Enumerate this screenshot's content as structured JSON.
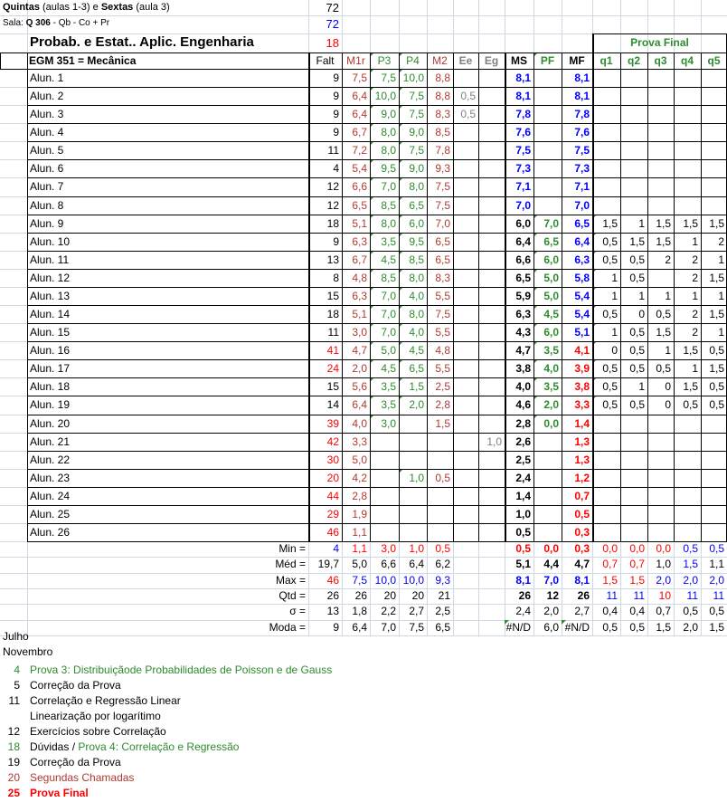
{
  "header": {
    "days_b1": "Quintas",
    "days_n1": " (aulas 1-3) e ",
    "days_b2": "Sextas",
    "days_n2": " (aula 3)",
    "days_val": "72",
    "room_label": "Sala: ",
    "room_b": "Q 306",
    "room_rest": " - Qb - Co + Pr",
    "room_val": "72",
    "title": "Probab. e Estat.. Aplic. Engenharia",
    "title_val": "18",
    "course": "EGM 351 = Mecânica",
    "prova_final": "Prova Final"
  },
  "columns": [
    "Falt",
    "M1r",
    "P3",
    "P4",
    "M2",
    "Ee",
    "Eg",
    "MS",
    "PF",
    "MF",
    "q1",
    "q2",
    "q3",
    "q4",
    "q5"
  ],
  "students": [
    {
      "name": "Alun. 1",
      "falt": "9",
      "m1r": "7,5",
      "p3": "7,5",
      "p4": "10,0",
      "m2": "8,8",
      "ee": "",
      "eg": "",
      "ms": "8,1",
      "pf": "",
      "mf": "8,1",
      "q": [
        "",
        "",
        "",
        "",
        ""
      ]
    },
    {
      "name": "Alun. 2",
      "falt": "9",
      "m1r": "6,4",
      "p3": "10,0",
      "p4": "7,5",
      "m2": "8,8",
      "ee": "0,5",
      "eg": "",
      "ms": "8,1",
      "pf": "",
      "mf": "8,1",
      "q": [
        "",
        "",
        "",
        "",
        ""
      ]
    },
    {
      "name": "Alun. 3",
      "falt": "9",
      "m1r": "6,4",
      "p3": "9,0",
      "p4": "7,5",
      "m2": "8,3",
      "ee": "0,5",
      "eg": "",
      "ms": "7,8",
      "pf": "",
      "mf": "7,8",
      "q": [
        "",
        "",
        "",
        "",
        ""
      ]
    },
    {
      "name": "Alun. 4",
      "falt": "9",
      "m1r": "6,7",
      "p3": "8,0",
      "p4": "9,0",
      "m2": "8,5",
      "ee": "",
      "eg": "",
      "ms": "7,6",
      "pf": "",
      "mf": "7,6",
      "q": [
        "",
        "",
        "",
        "",
        ""
      ]
    },
    {
      "name": "Alun. 5",
      "falt": "11",
      "m1r": "7,2",
      "p3": "8,0",
      "p4": "7,5",
      "m2": "7,8",
      "ee": "",
      "eg": "",
      "ms": "7,5",
      "pf": "",
      "mf": "7,5",
      "q": [
        "",
        "",
        "",
        "",
        ""
      ]
    },
    {
      "name": "Alun. 6",
      "falt": "4",
      "m1r": "5,4",
      "p3": "9,5",
      "p4": "9,0",
      "m2": "9,3",
      "ee": "",
      "eg": "",
      "ms": "7,3",
      "pf": "",
      "mf": "7,3",
      "q": [
        "",
        "",
        "",
        "",
        ""
      ]
    },
    {
      "name": "Alun. 7",
      "falt": "12",
      "m1r": "6,6",
      "p3": "7,0",
      "p4": "8,0",
      "m2": "7,5",
      "ee": "",
      "eg": "",
      "ms": "7,1",
      "pf": "",
      "mf": "7,1",
      "q": [
        "",
        "",
        "",
        "",
        ""
      ]
    },
    {
      "name": "Alun. 8",
      "falt": "12",
      "m1r": "6,5",
      "p3": "8,5",
      "p4": "6,5",
      "m2": "7,5",
      "ee": "",
      "eg": "",
      "ms": "7,0",
      "pf": "",
      "mf": "7,0",
      "q": [
        "",
        "",
        "",
        "",
        ""
      ]
    },
    {
      "name": "Alun. 9",
      "falt": "18",
      "m1r": "5,1",
      "p3": "8,0",
      "p4": "6,0",
      "m2": "7,0",
      "ee": "",
      "eg": "",
      "ms": "6,0",
      "pf": "7,0",
      "mf": "6,5",
      "q": [
        "1,5",
        "1",
        "1,5",
        "1,5",
        "1,5"
      ]
    },
    {
      "name": "Alun. 10",
      "falt": "9",
      "m1r": "6,3",
      "p3": "3,5",
      "p4": "9,5",
      "m2": "6,5",
      "ee": "",
      "eg": "",
      "ms": "6,4",
      "pf": "6,5",
      "mf": "6,4",
      "q": [
        "0,5",
        "1,5",
        "1,5",
        "1",
        "2"
      ]
    },
    {
      "name": "Alun. 11",
      "falt": "13",
      "m1r": "6,7",
      "p3": "4,5",
      "p4": "8,5",
      "m2": "6,5",
      "ee": "",
      "eg": "",
      "ms": "6,6",
      "pf": "6,0",
      "mf": "6,3",
      "q": [
        "0,5",
        "0,5",
        "2",
        "2",
        "1"
      ]
    },
    {
      "name": "Alun. 12",
      "falt": "8",
      "m1r": "4,8",
      "p3": "8,5",
      "p4": "8,0",
      "m2": "8,3",
      "ee": "",
      "eg": "",
      "ms": "6,5",
      "pf": "5,0",
      "mf": "5,8",
      "q": [
        "1",
        "0,5",
        "",
        "2",
        "1,5"
      ]
    },
    {
      "name": "Alun. 13",
      "falt": "15",
      "m1r": "6,3",
      "p3": "7,0",
      "p4": "4,0",
      "m2": "5,5",
      "ee": "",
      "eg": "",
      "ms": "5,9",
      "pf": "5,0",
      "mf": "5,4",
      "q": [
        "1",
        "1",
        "1",
        "1",
        "1"
      ]
    },
    {
      "name": "Alun. 14",
      "falt": "18",
      "m1r": "5,1",
      "p3": "7,0",
      "p4": "8,0",
      "m2": "7,5",
      "ee": "",
      "eg": "",
      "ms": "6,3",
      "pf": "4,5",
      "mf": "5,4",
      "q": [
        "0,5",
        "0",
        "0,5",
        "2",
        "1,5"
      ]
    },
    {
      "name": "Alun. 15",
      "falt": "11",
      "m1r": "3,0",
      "p3": "7,0",
      "p4": "4,0",
      "m2": "5,5",
      "ee": "",
      "eg": "",
      "ms": "4,3",
      "pf": "6,0",
      "mf": "5,1",
      "q": [
        "1",
        "0,5",
        "1,5",
        "2",
        "1"
      ]
    },
    {
      "name": "Alun. 16",
      "falt": "41",
      "m1r": "4,7",
      "p3": "5,0",
      "p4": "4,5",
      "m2": "4,8",
      "ee": "",
      "eg": "",
      "ms": "4,7",
      "pf": "3,5",
      "mf": "4,1",
      "q": [
        "0",
        "0,5",
        "1",
        "1,5",
        "0,5"
      ]
    },
    {
      "name": "Alun. 17",
      "falt": "24",
      "m1r": "2,0",
      "p3": "4,5",
      "p4": "6,5",
      "m2": "5,5",
      "ee": "",
      "eg": "",
      "ms": "3,8",
      "pf": "4,0",
      "mf": "3,9",
      "q": [
        "0,5",
        "0,5",
        "0,5",
        "1",
        "1,5"
      ]
    },
    {
      "name": "Alun. 18",
      "falt": "15",
      "m1r": "5,6",
      "p3": "3,5",
      "p4": "1,5",
      "m2": "2,5",
      "ee": "",
      "eg": "",
      "ms": "4,0",
      "pf": "3,5",
      "mf": "3,8",
      "q": [
        "0,5",
        "1",
        "0",
        "1,5",
        "0,5"
      ]
    },
    {
      "name": "Alun. 19",
      "falt": "14",
      "m1r": "6,4",
      "p3": "3,5",
      "p4": "2,0",
      "m2": "2,8",
      "ee": "",
      "eg": "",
      "ms": "4,6",
      "pf": "2,0",
      "mf": "3,3",
      "q": [
        "0,5",
        "0,5",
        "0",
        "0,5",
        "0,5"
      ]
    },
    {
      "name": "Alun. 20",
      "falt": "39",
      "m1r": "4,0",
      "p3": "3,0",
      "p4": "",
      "m2": "1,5",
      "ee": "",
      "eg": "",
      "ms": "2,8",
      "pf": "0,0",
      "mf": "1,4",
      "q": [
        "",
        "",
        "",
        "",
        ""
      ]
    },
    {
      "name": "Alun. 21",
      "falt": "42",
      "m1r": "3,3",
      "p3": "",
      "p4": "",
      "m2": "",
      "ee": "",
      "eg": "1,0",
      "ms": "2,6",
      "pf": "",
      "mf": "1,3",
      "q": [
        "",
        "",
        "",
        "",
        ""
      ]
    },
    {
      "name": "Alun. 22",
      "falt": "30",
      "m1r": "5,0",
      "p3": "",
      "p4": "",
      "m2": "",
      "ee": "",
      "eg": "",
      "ms": "2,5",
      "pf": "",
      "mf": "1,3",
      "q": [
        "",
        "",
        "",
        "",
        ""
      ]
    },
    {
      "name": "Alun. 23",
      "falt": "20",
      "m1r": "4,2",
      "p3": "",
      "p4": "1,0",
      "m2": "0,5",
      "ee": "",
      "eg": "",
      "ms": "2,4",
      "pf": "",
      "mf": "1,2",
      "q": [
        "",
        "",
        "",
        "",
        ""
      ]
    },
    {
      "name": "Alun. 24",
      "falt": "44",
      "m1r": "2,8",
      "p3": "",
      "p4": "",
      "m2": "",
      "ee": "",
      "eg": "",
      "ms": "1,4",
      "pf": "",
      "mf": "0,7",
      "q": [
        "",
        "",
        "",
        "",
        ""
      ]
    },
    {
      "name": "Alun. 25",
      "falt": "29",
      "m1r": "1,9",
      "p3": "",
      "p4": "",
      "m2": "",
      "ee": "",
      "eg": "",
      "ms": "1,0",
      "pf": "",
      "mf": "0,5",
      "q": [
        "",
        "",
        "",
        "",
        ""
      ]
    },
    {
      "name": "Alun. 26",
      "falt": "46",
      "m1r": "1,1",
      "p3": "",
      "p4": "",
      "m2": "",
      "ee": "",
      "eg": "",
      "ms": "0,5",
      "pf": "",
      "mf": "0,3",
      "q": [
        "",
        "",
        "",
        "",
        ""
      ]
    }
  ],
  "stats": [
    {
      "label": "Min =",
      "falt": "4",
      "m1r": "1,1",
      "p3": "3,0",
      "p4": "1,0",
      "m2": "0,5",
      "ms": "0,5",
      "pf": "0,0",
      "mf": "0,3",
      "q": [
        "0,0",
        "0,0",
        "0,0",
        "0,5",
        "0,5"
      ]
    },
    {
      "label": "Méd =",
      "falt": "19,7",
      "m1r": "5,0",
      "p3": "6,6",
      "p4": "6,4",
      "m2": "6,2",
      "ms": "5,1",
      "pf": "4,4",
      "mf": "4,7",
      "q": [
        "0,7",
        "0,7",
        "1,0",
        "1,5",
        "1,1"
      ]
    },
    {
      "label": "Max =",
      "falt": "46",
      "m1r": "7,5",
      "p3": "10,0",
      "p4": "10,0",
      "m2": "9,3",
      "ms": "8,1",
      "pf": "7,0",
      "mf": "8,1",
      "q": [
        "1,5",
        "1,5",
        "2,0",
        "2,0",
        "2,0"
      ]
    },
    {
      "label": "Qtd =",
      "falt": "26",
      "m1r": "26",
      "p3": "20",
      "p4": "20",
      "m2": "21",
      "ms": "26",
      "pf": "12",
      "mf": "26",
      "q": [
        "11",
        "11",
        "10",
        "11",
        "11"
      ]
    },
    {
      "label": "σ =",
      "falt": "13",
      "m1r": "1,8",
      "p3": "2,2",
      "p4": "2,7",
      "m2": "2,5",
      "ms": "2,4",
      "pf": "2,0",
      "mf": "2,7",
      "q": [
        "0,4",
        "0,4",
        "0,7",
        "0,5",
        "0,5"
      ]
    },
    {
      "label": "Moda =",
      "falt": "9",
      "m1r": "6,4",
      "p3": "7,0",
      "p4": "7,5",
      "m2": "6,5",
      "ms": "#N/D",
      "pf": "6,0",
      "mf": "#N/D",
      "q": [
        "0,5",
        "0,5",
        "1,5",
        "2,0",
        "1,5"
      ]
    }
  ],
  "schedule": {
    "julho": "Julho",
    "novembro": "Novembro",
    "items": [
      {
        "day": "4",
        "text": "Prova 3: Distribuiçãode Probabilidades de Poisson e de Gauss",
        "color": "#2e8b2e"
      },
      {
        "day": "5",
        "text": "Correção da Prova",
        "color": "#000000"
      },
      {
        "day": "11",
        "text": "Correlação e Regressão Linear",
        "color": "#000000"
      },
      {
        "day": "",
        "text": "Linearização por logarítimo",
        "color": "#000000"
      },
      {
        "day": "12",
        "text": "Exercícios sobre Correlação",
        "color": "#000000"
      },
      {
        "day": "18",
        "text": "Dúvidas / ",
        "text2": "Prova 4: Correlação e Regressão",
        "color": "#000000",
        "color2": "#2e8b2e",
        "daycolor": "#2e8b2e"
      },
      {
        "day": "19",
        "text": "Correção da Prova",
        "color": "#000000"
      },
      {
        "day": "20",
        "text": "Segundas Chamadas",
        "color": "#b03a2e"
      },
      {
        "day": "25",
        "text": "Prova Final",
        "color": "#ff0000",
        "bold": true
      }
    ]
  },
  "colors": {
    "red": "#ff0000",
    "darkred": "#b03a2e",
    "green": "#2e8b2e",
    "blue": "#0000ff",
    "gray": "#808080",
    "border": "#000000",
    "gridline": "#d0d7e5"
  }
}
